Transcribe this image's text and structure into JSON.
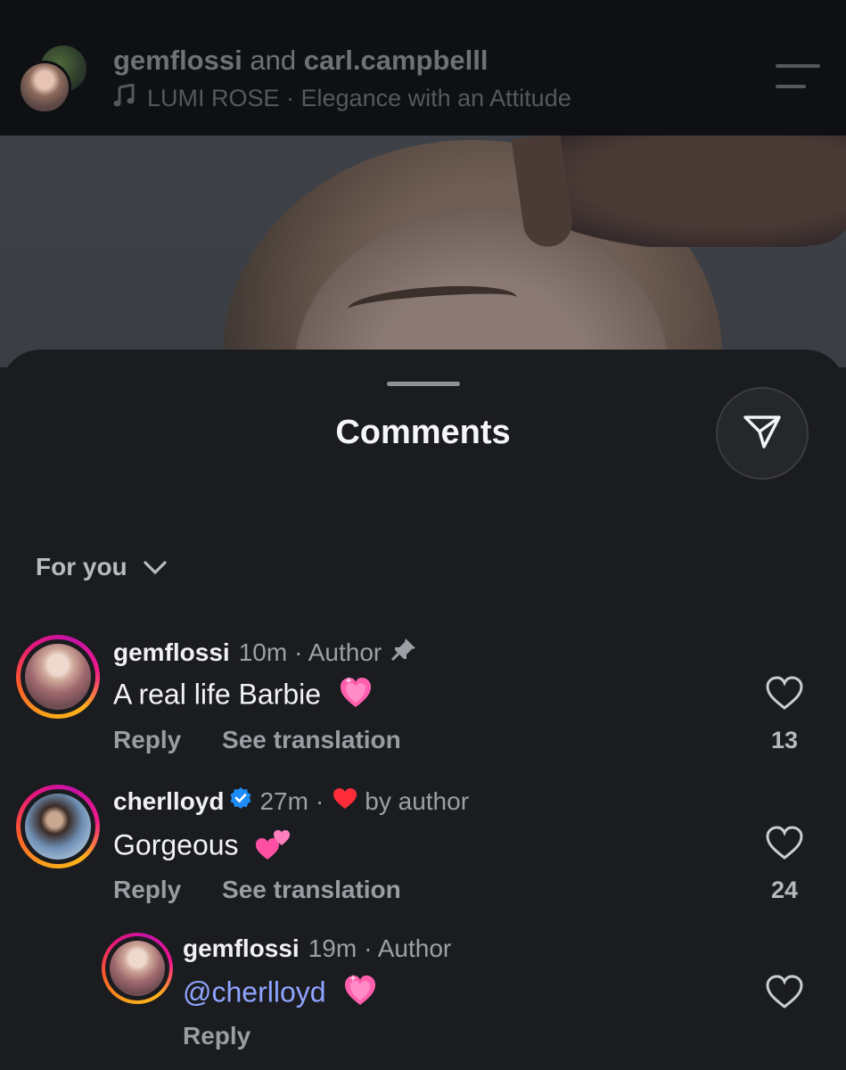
{
  "header": {
    "user1": "gemflossi",
    "joiner": "and",
    "user2": "carl.campbelll",
    "music": "LUMI ROSE · Elegance with an Attitude",
    "icons": [
      "music-note-icon",
      "menu-icon"
    ]
  },
  "sheet": {
    "title": "Comments",
    "sort_label": "For you",
    "icons": [
      "share-icon",
      "chevron-down-icon"
    ]
  },
  "comments": [
    {
      "username": "gemflossi",
      "time": "10m",
      "meta": "· Author",
      "text": "A real life Barbie",
      "emoji": "pink-sparkle-heart",
      "reply_label": "Reply",
      "translate_label": "See translation",
      "likes": "13",
      "pinned": true
    },
    {
      "username": "cherlloyd",
      "verified": true,
      "time": "27m",
      "meta_sep": "·",
      "meta": "by author",
      "text": "Gorgeous",
      "emoji": "two-hearts",
      "reply_label": "Reply",
      "translate_label": "See translation",
      "likes": "24"
    },
    {
      "username": "gemflossi",
      "time": "19m",
      "meta": "· Author",
      "text": "@cherlloyd",
      "emoji": "pink-sparkle-heart",
      "reply_label": "Reply",
      "is_reply": true
    }
  ],
  "colors": {
    "background": "#1b1c1f",
    "header_bg": "#0e1013",
    "mention": "#8fa4ff",
    "verified": "#1d8cf8",
    "heart_red": "#ff2d3a",
    "emoji_pink": "#ff5fae"
  }
}
